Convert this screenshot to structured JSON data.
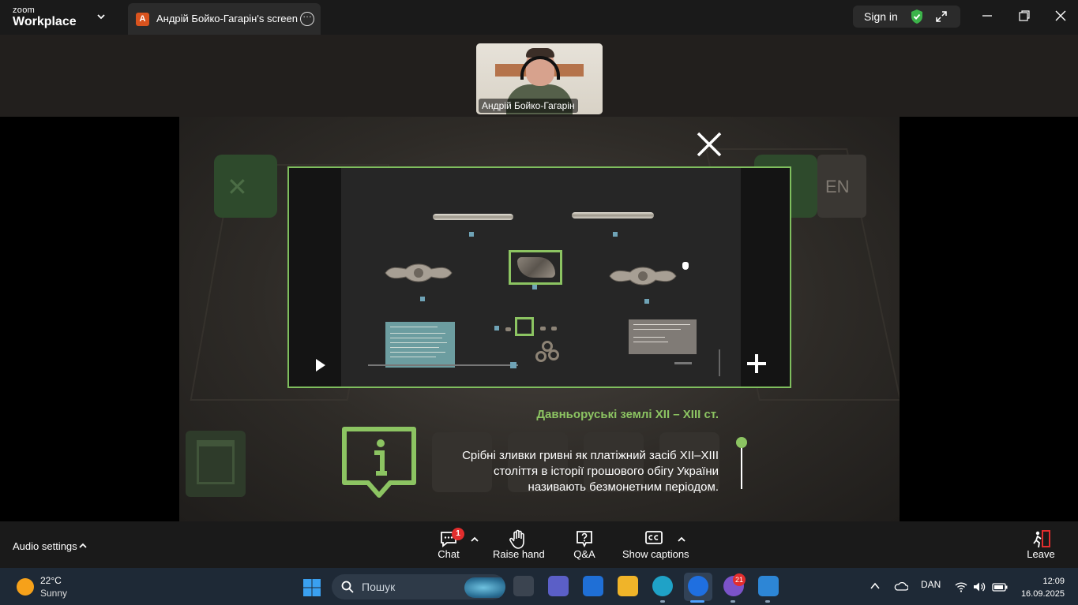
{
  "app": {
    "brand_small": "zoom",
    "brand_big": "Workplace",
    "share_tab_avatar": "A",
    "share_tab_title": "Андрій Бойко-Гагарін's screen",
    "sign_in": "Sign in",
    "icons": [
      "chevron-down-icon",
      "more-icon",
      "shield-check-icon",
      "expand-icon",
      "minimize-icon",
      "restore-icon",
      "close-icon"
    ]
  },
  "participant": {
    "name": "Андрій Бойко-Гагарін"
  },
  "shared_screen": {
    "lang_button": "EN",
    "caption_title": "Давньоруські землі XII – XIII ст.",
    "caption_text": "Срібні зливки гривні як платіжний засіб XII–XIII століття в історії грошового обігу України називають безмонетним періодом.",
    "accent_color": "#8cc462"
  },
  "controls": {
    "audio_settings": "Audio settings",
    "chat": "Chat",
    "chat_badge": "1",
    "raise_hand": "Raise hand",
    "qa": "Q&A",
    "captions": "Show captions",
    "leave": "Leave"
  },
  "taskbar": {
    "temperature": "22°C",
    "weather": "Sunny",
    "search_placeholder": "Пошук",
    "viber_badge": "21",
    "language": "DAN",
    "time": "12:09",
    "date": "16.09.2025"
  }
}
